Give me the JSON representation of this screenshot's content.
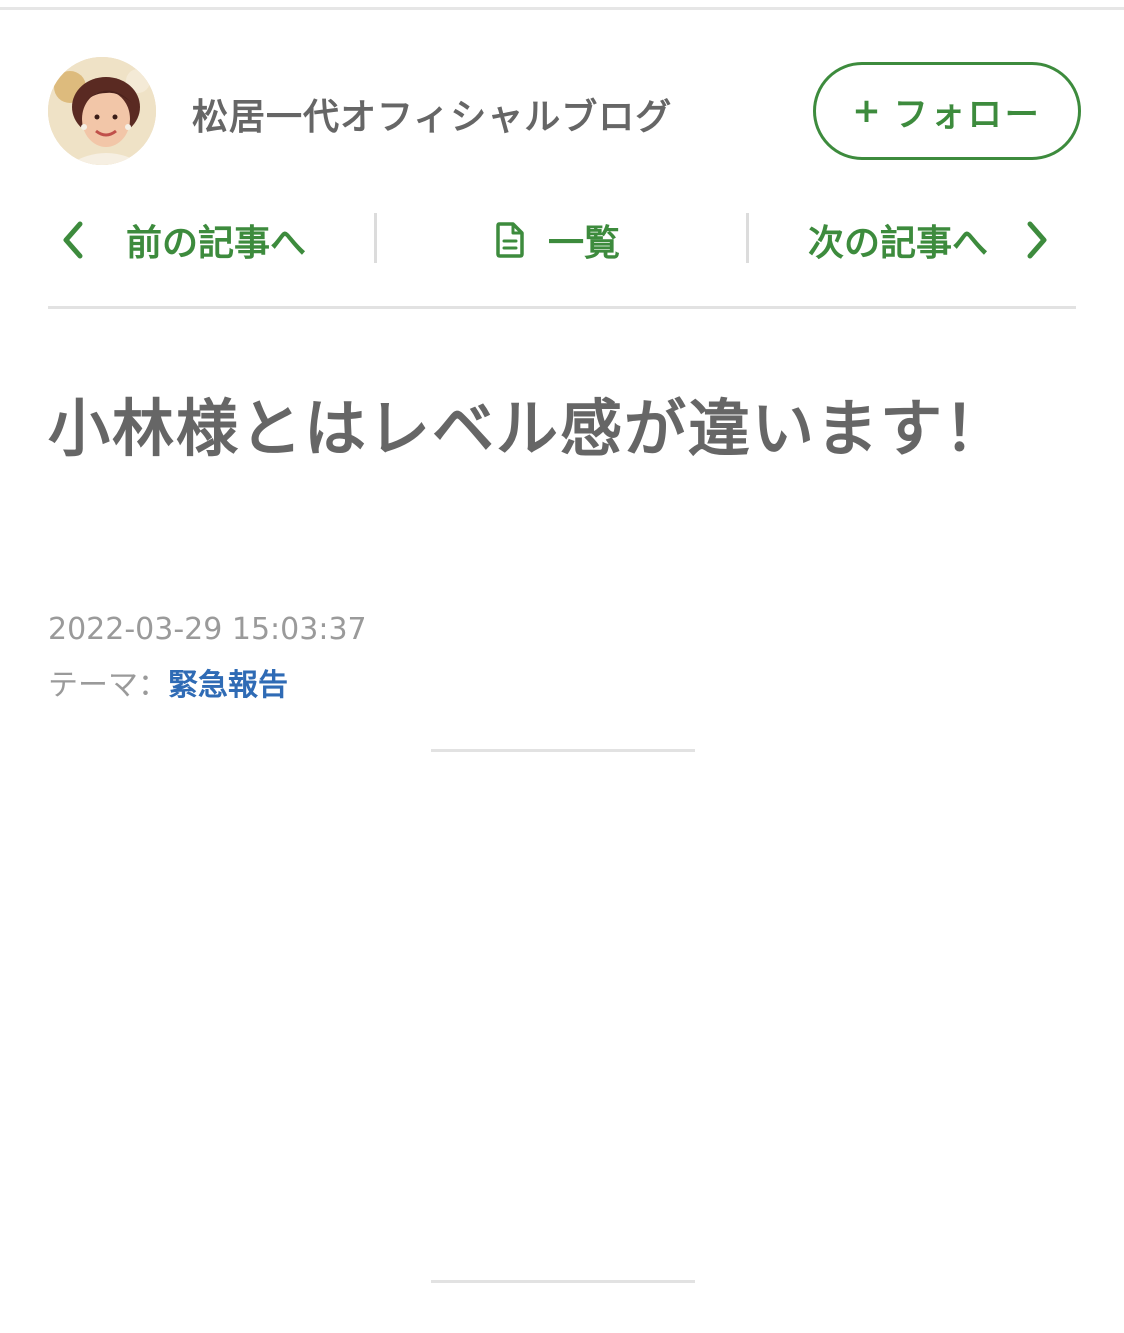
{
  "header": {
    "blog_title": "松居一代オフィシャルブログ",
    "follow_plus": "+",
    "follow_label": "フォロー"
  },
  "nav": {
    "prev_label": "前の記事へ",
    "list_label": "一覧",
    "next_label": "次の記事へ"
  },
  "article": {
    "title": "小林様とはレベル感が違います！",
    "date": "2022-03-29 15:03:37",
    "theme_prefix": "テーマ：",
    "theme_name": "緊急報告"
  },
  "colors": {
    "accent_green": "#3d8b3d",
    "link_blue": "#2f6bb5",
    "title_gray": "#666666",
    "meta_gray": "#9a9a9a"
  },
  "icons": {
    "prev": "chevron-left-icon",
    "list": "document-icon",
    "next": "chevron-right-icon"
  }
}
